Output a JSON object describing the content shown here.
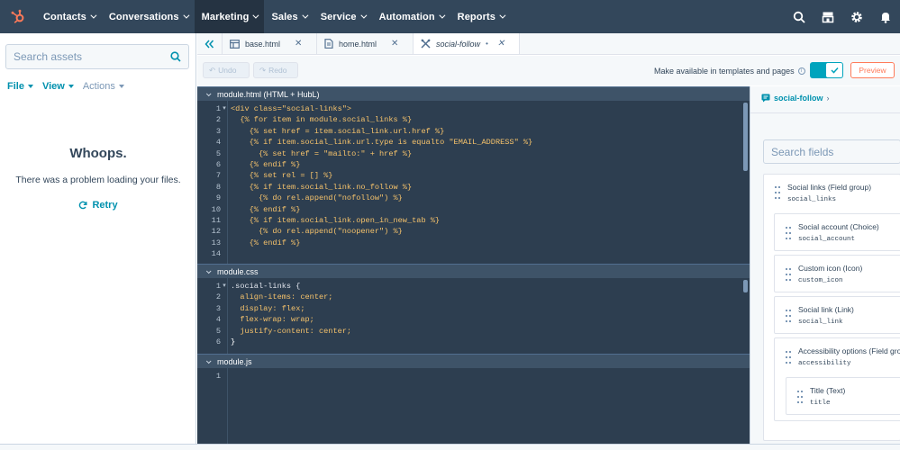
{
  "colors": {
    "nav_bg": "#33475b",
    "accent": "#0091ae",
    "orange": "#ff7a59",
    "editor_bg": "#2d3e50",
    "toggle": "#00a4bd"
  },
  "topnav": {
    "items": [
      {
        "label": "Contacts",
        "active": false
      },
      {
        "label": "Conversations",
        "active": false
      },
      {
        "label": "Marketing",
        "active": true
      },
      {
        "label": "Sales",
        "active": false
      },
      {
        "label": "Service",
        "active": false
      },
      {
        "label": "Automation",
        "active": false
      },
      {
        "label": "Reports",
        "active": false
      }
    ],
    "icons": [
      "search-icon",
      "marketplace-icon",
      "settings-icon",
      "notifications-icon"
    ]
  },
  "left": {
    "search_placeholder": "Search assets",
    "menu": {
      "file": "File",
      "view": "View",
      "actions": "Actions"
    },
    "empty_title": "Whoops.",
    "empty_text": "There was a problem loading your files.",
    "retry": "Retry"
  },
  "tabs": [
    {
      "label": "base.html",
      "icon": "layout-icon"
    },
    {
      "label": "home.html",
      "icon": "document-icon"
    },
    {
      "label": "social-follow",
      "icon": "module-icon",
      "active": true
    }
  ],
  "toolbar": {
    "undo": "Undo",
    "redo": "Redo",
    "available_label": "Make available in templates and pages",
    "preview": "Preview"
  },
  "sections": {
    "html": "module.html (HTML + HubL)",
    "css": "module.css",
    "js": "module.js"
  },
  "code": {
    "html": [
      "<div class=\"social-links\">",
      "  {% for item in module.social_links %}",
      "    {% set href = item.social_link.url.href %}",
      "    {% if item.social_link.url.type is equalto \"EMAIL_ADDRESS\" %}",
      "      {% set href = \"mailto:\" + href %}",
      "    {% endif %}",
      "    {% set rel = [] %}",
      "    {% if item.social_link.no_follow %}",
      "      {% do rel.append(\"nofollow\") %}",
      "    {% endif %}",
      "    {% if item.social_link.open_in_new_tab %}",
      "      {% do rel.append(\"noopener\") %}",
      "    {% endif %}",
      ""
    ],
    "css": [
      ".social-links {",
      "  align-items: center;",
      "  display: flex;",
      "  flex-wrap: wrap;",
      "  justify-content: center;",
      "}"
    ],
    "js": [
      ""
    ]
  },
  "right": {
    "breadcrumb": "social-follow",
    "search_placeholder": "Search fields",
    "fields": [
      {
        "label": "Social links (Field group)",
        "name": "social_links"
      },
      {
        "label": "Social account (Choice)",
        "name": "social_account"
      },
      {
        "label": "Custom icon (Icon)",
        "name": "custom_icon"
      },
      {
        "label": "Social link (Link)",
        "name": "social_link"
      },
      {
        "label": "Accessibility options (Field group)",
        "name": "accessibility"
      },
      {
        "label": "Title (Text)",
        "name": "title"
      }
    ]
  }
}
